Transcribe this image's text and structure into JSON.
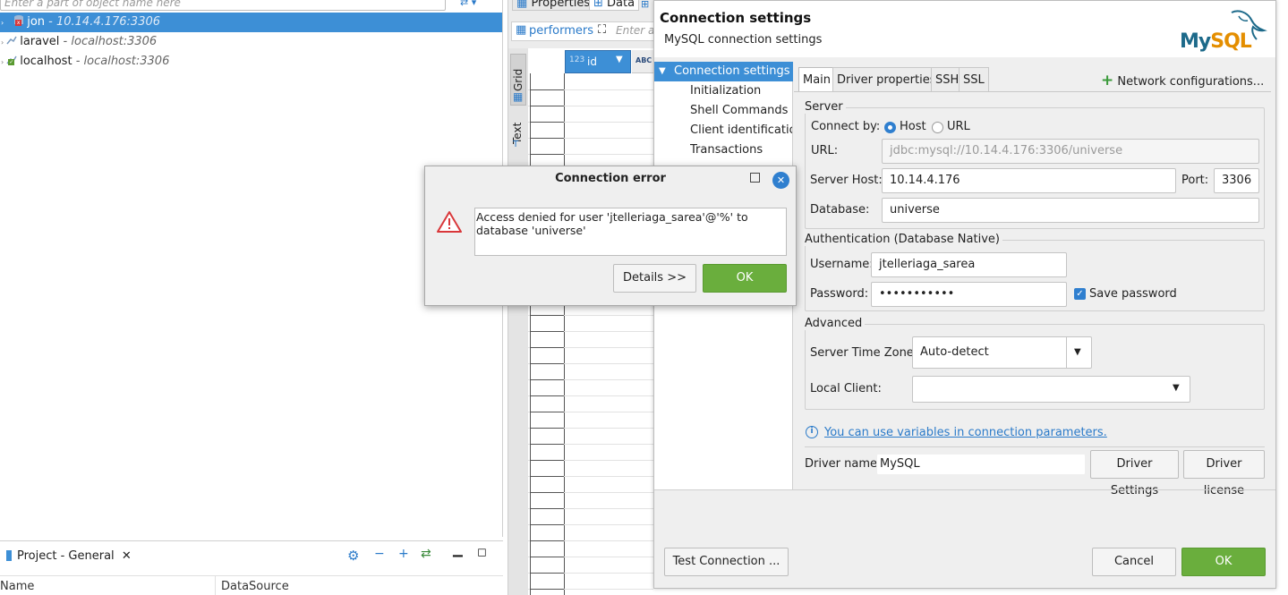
{
  "navigator": {
    "filter_placeholder": "Enter a part of object name here",
    "connections": [
      {
        "name": "jon",
        "host": "10.14.4.176:3306",
        "selected": true
      },
      {
        "name": "laravel",
        "host": "localhost:3306",
        "selected": false
      },
      {
        "name": "localhost",
        "host": "localhost:3306",
        "selected": false
      }
    ]
  },
  "project": {
    "tab_label": "Project - General",
    "col_name": "Name",
    "col_datasource": "DataSource"
  },
  "editor": {
    "tab_properties": "Properties",
    "tab_data": "Data",
    "table_name": "performers",
    "filter_placeholder": "Enter a",
    "side_grid": "Grid",
    "side_text": "Text",
    "col_id": "id",
    "col_id_type": "123",
    "col_abc": "ABC"
  },
  "connection_settings": {
    "title": "Connection settings",
    "subtitle": "MySQL connection settings",
    "logo_text": "MySQL",
    "nav": {
      "selected": "Connection settings",
      "items": [
        "Initialization",
        "Shell Commands",
        "Client identification",
        "Transactions"
      ]
    },
    "tabs": [
      "Main",
      "Driver properties",
      "SSH",
      "SSL"
    ],
    "network_config": "Network configurations...",
    "server": {
      "group": "Server",
      "connect_by_label": "Connect by:",
      "option_host": "Host",
      "option_url": "URL",
      "url_label": "URL:",
      "url_value": "jdbc:mysql://10.14.4.176:3306/universe",
      "host_label": "Server Host:",
      "host_value": "10.14.4.176",
      "port_label": "Port:",
      "port_value": "3306",
      "database_label": "Database:",
      "database_value": "universe"
    },
    "auth": {
      "group": "Authentication (Database Native)",
      "username_label": "Username:",
      "username_value": "jtelleriaga_sarea",
      "password_label": "Password:",
      "password_value": "•••••••••••",
      "save_password": "Save password"
    },
    "advanced": {
      "group": "Advanced",
      "timezone_label": "Server Time Zone:",
      "timezone_value": "Auto-detect",
      "local_client_label": "Local Client:",
      "local_client_value": ""
    },
    "variables_link": "You can use variables in connection parameters.",
    "driver_label": "Driver name:",
    "driver_value": "MySQL",
    "driver_settings_btn": "Driver Settings",
    "driver_license_btn": "Driver license",
    "test_btn": "Test Connection ...",
    "cancel_btn": "Cancel",
    "ok_btn": "OK"
  },
  "error_dialog": {
    "title": "Connection error",
    "message": "Access denied for user 'jtelleriaga_sarea'@'%' to database 'universe'",
    "details_btn": "Details >>",
    "ok_btn": "OK"
  },
  "colors": {
    "selection": "#3d8fd6",
    "ok_green": "#6aae3d",
    "link_blue": "#2a7ac9",
    "error_red": "#d9373a"
  }
}
